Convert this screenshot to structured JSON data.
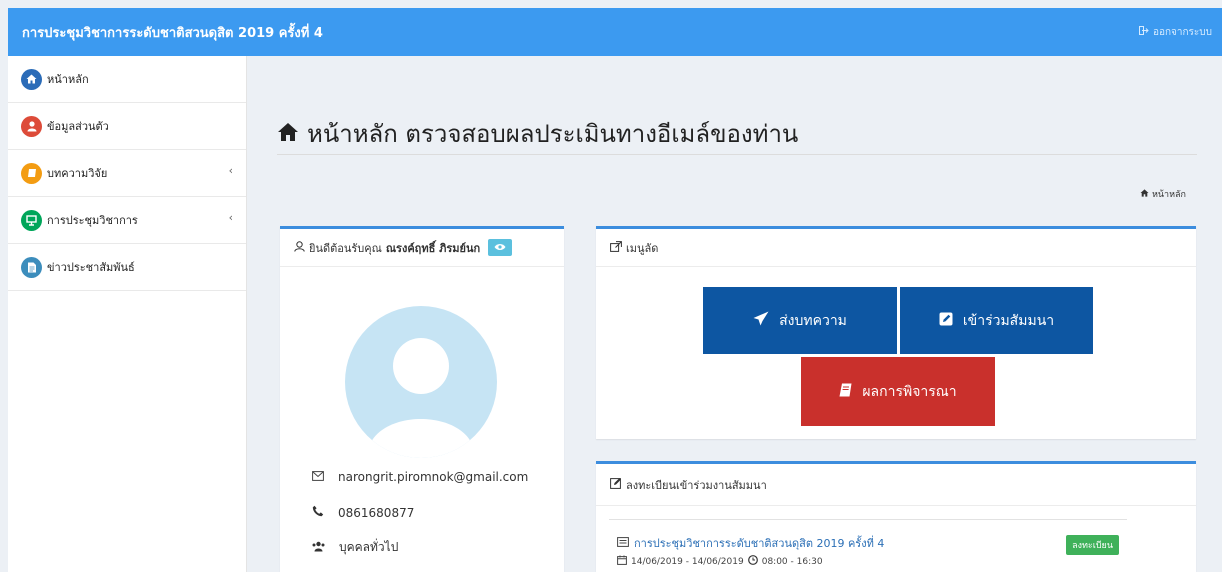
{
  "header": {
    "title": "การประชุมวิชาการระดับชาติสวนดุสิต 2019 ครั้งที่ 4",
    "logout_label": "ออกจากระบบ"
  },
  "sidebar": {
    "items": [
      {
        "label": "หน้าหลัก",
        "icon": "home-icon",
        "color": "#2b6cb8"
      },
      {
        "label": "ข้อมูลส่วนตัว",
        "icon": "user-icon",
        "color": "#dd4b39"
      },
      {
        "label": "บทความวิจัย",
        "icon": "book-icon",
        "color": "#f39c12"
      },
      {
        "label": "การประชุมวิชาการ",
        "icon": "presentation-icon",
        "color": "#00a65a"
      },
      {
        "label": "ข่าวประชาสัมพันธ์",
        "icon": "news-icon",
        "color": "#3c8dbc"
      }
    ]
  },
  "page": {
    "title": "หน้าหลัก ตรวจสอบผลประเมินทางอีเมล์ของท่าน",
    "breadcrumb": "หน้าหลัก"
  },
  "profile": {
    "welcome": "ยินดีต้อนรับคุณ",
    "name": "ณรงค์ฤทธิ์ ภิรมย์นก",
    "email": "narongrit.piromnok@gmail.com",
    "phone": "0861680877",
    "group": "บุคคลทั่วไป"
  },
  "shortcuts": {
    "title": "เมนูลัด",
    "submit_label": "ส่งบทความ",
    "join_label": "เข้าร่วมสัมมนา",
    "result_label": "ผลการพิจารณา"
  },
  "registration": {
    "title": "ลงทะเบียนเข้าร่วมงานสัมมนา",
    "event_name": "การประชุมวิชาการระดับชาติสวนดุสิต 2019 ครั้งที่ 4",
    "event_date": "14/06/2019 - 14/06/2019",
    "event_time": "08:00 - 16:30",
    "register_label": "ลงทะเบียน"
  },
  "colors": {
    "topbar": "#3c9af0",
    "card_border": "#3c8dde",
    "button_blue": "#0d56a2",
    "button_red": "#c9302c",
    "badge_green": "#3fb15a"
  }
}
